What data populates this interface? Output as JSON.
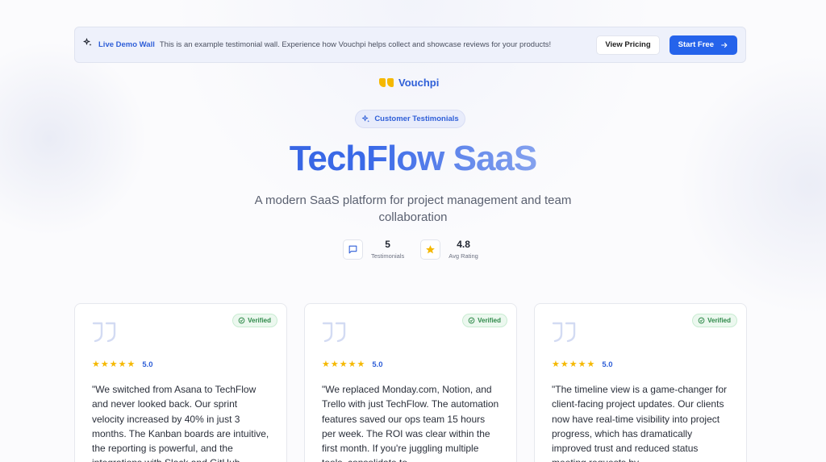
{
  "banner": {
    "title": "Live Demo Wall",
    "description": "This is an example testimonial wall. Experience how Vouchpi helps collect and showcase reviews for your products!",
    "pricing_label": "View Pricing",
    "start_label": "Start Free"
  },
  "brand": {
    "name": "Vouchpi"
  },
  "pill": {
    "label": "Customer Testimonials"
  },
  "hero": {
    "title": "TechFlow SaaS",
    "subtitle": "A modern SaaS platform for project management and team collaboration"
  },
  "stats": [
    {
      "value": "5",
      "label": "Testimonials",
      "icon": "message-square-icon"
    },
    {
      "value": "4.8",
      "label": "Avg Rating",
      "icon": "star-icon"
    }
  ],
  "testimonials": [
    {
      "rating": "5.0",
      "stars": 5,
      "verified": "Verified",
      "text": "\"We switched from Asana to TechFlow and never looked back. Our sprint velocity increased by 40% in just 3 months. The Kanban boards are intuitive, the reporting is powerful, and the integrations with Slack and GitHub"
    },
    {
      "rating": "5.0",
      "stars": 5,
      "verified": "Verified",
      "text": "\"We replaced Monday.com, Notion, and Trello with just TechFlow. The automation features saved our ops team 15 hours per week. The ROI was clear within the first month. If you're juggling multiple tools, consolidate to"
    },
    {
      "rating": "5.0",
      "stars": 5,
      "verified": "Verified",
      "text": "\"The timeline view is a game-changer for client-facing project updates. Our clients now have real-time visibility into project progress, which has dramatically improved trust and reduced status meeting requests by"
    }
  ],
  "colors": {
    "accent": "#2563eb",
    "brand_text": "#2f5fd8",
    "star": "#f5b800",
    "verified": "#2f8a4a"
  }
}
